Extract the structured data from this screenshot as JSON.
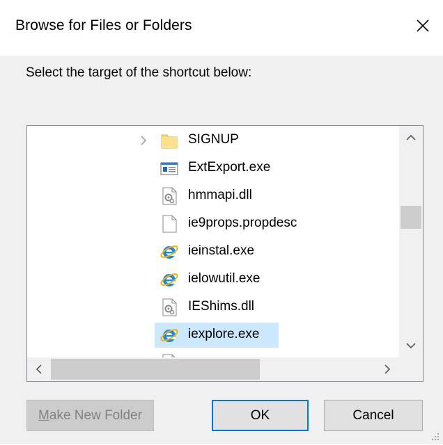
{
  "dialog": {
    "title": "Browse for Files or Folders",
    "instruction": "Select the target of the shortcut below:"
  },
  "tree": {
    "items": [
      {
        "label": "SIGNUP",
        "icon": "folder-icon",
        "expandable": true,
        "selected": false
      },
      {
        "label": "ExtExport.exe",
        "icon": "application-icon",
        "expandable": false,
        "selected": false
      },
      {
        "label": "hmmapi.dll",
        "icon": "dll-file-icon",
        "expandable": false,
        "selected": false
      },
      {
        "label": "ie9props.propdesc",
        "icon": "blank-file-icon",
        "expandable": false,
        "selected": false
      },
      {
        "label": "ieinstal.exe",
        "icon": "internet-explorer-icon",
        "expandable": false,
        "selected": false
      },
      {
        "label": "ielowutil.exe",
        "icon": "internet-explorer-icon",
        "expandable": false,
        "selected": false
      },
      {
        "label": "IEShims.dll",
        "icon": "dll-file-icon",
        "expandable": false,
        "selected": false
      },
      {
        "label": "iexplore.exe",
        "icon": "internet-explorer-icon",
        "expandable": false,
        "selected": true
      }
    ],
    "vertical_scroll_position": 0.35
  },
  "buttons": {
    "new_folder_prefix": "",
    "new_folder_mnemonic": "M",
    "new_folder_rest": "ake New Folder",
    "ok_label": "OK",
    "cancel_label": "Cancel"
  },
  "colors": {
    "selection": "#cce8ff",
    "accent": "#0078d7",
    "folder": "#f8d775",
    "ie_blue": "#1e88e5"
  }
}
